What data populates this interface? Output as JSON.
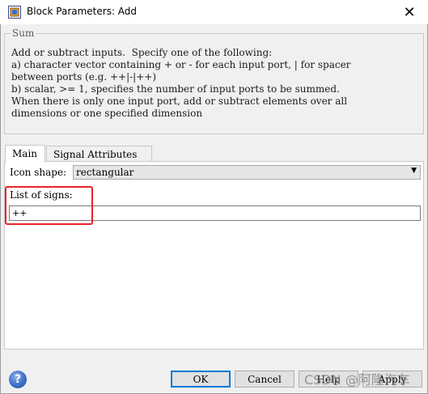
{
  "window": {
    "title": "Block Parameters: Add",
    "close_glyph": "✕"
  },
  "description": {
    "group_label": "Sum",
    "lines": [
      "Add or subtract inputs.  Specify one of the following:",
      "a) character vector containing + or - for each input port, | for spacer",
      "between ports (e.g. ++|-|++)",
      "b) scalar, >= 1, specifies the number of input ports to be summed.",
      "When there is only one input port, add or subtract elements over all",
      "dimensions or one specified dimension"
    ]
  },
  "tabs": [
    {
      "label": "Main",
      "active": true
    },
    {
      "label": "Signal Attributes",
      "active": false
    }
  ],
  "main": {
    "icon_shape_label": "Icon shape:",
    "icon_shape_value": "rectangular",
    "signs_label": "List of signs:",
    "signs_value": "++"
  },
  "buttons": {
    "ok": "OK",
    "cancel": "Cancel",
    "help": "Help",
    "apply": "Apply"
  },
  "watermark": "CSDN @阿隆汽车",
  "colors": {
    "highlight": "#e8232a",
    "accent": "#0078d7"
  },
  "icons": {
    "app": "simulink-block-icon",
    "help": "help-icon",
    "dropdown": "chevron-down-icon"
  }
}
